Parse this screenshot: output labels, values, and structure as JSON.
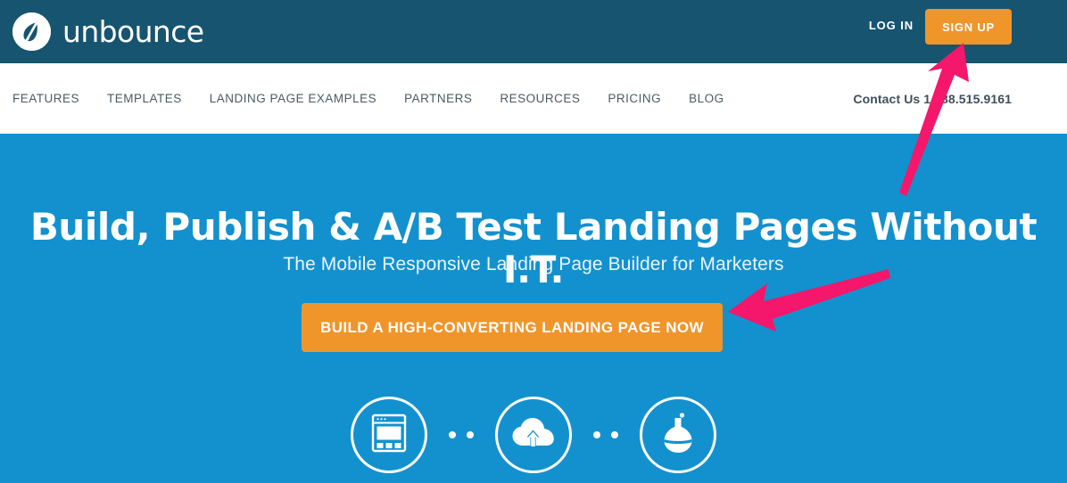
{
  "header": {
    "logo_icon": "unbounce-leaf-logo-icon",
    "logo_text": "unbounce",
    "login_label": "LOG IN",
    "signup_label": "SIGN UP",
    "background_color": "#175470",
    "signup_button_color": "#F0952A"
  },
  "nav": {
    "items": [
      {
        "label": "FEATURES"
      },
      {
        "label": "TEMPLATES"
      },
      {
        "label": "LANDING PAGE EXAMPLES"
      },
      {
        "label": "PARTNERS"
      },
      {
        "label": "RESOURCES"
      },
      {
        "label": "PRICING"
      },
      {
        "label": "BLOG"
      }
    ],
    "contact": "Contact Us 1.888.515.9161",
    "background_color": "#FFFFFF"
  },
  "hero": {
    "headline": "Build, Publish & A/B Test Landing Pages Without I.T.",
    "subheadline": "The Mobile Responsive Landing Page Builder for Marketers",
    "cta_label": "BUILD A HIGH-CONVERTING LANDING PAGE NOW",
    "background_color": "#1391CE",
    "cta_button_color": "#F0952A",
    "features": [
      {
        "icon": "landing-page-layout-icon",
        "name": "build"
      },
      {
        "icon": "cloud-upload-icon",
        "name": "publish"
      },
      {
        "icon": "flask-icon",
        "name": "test"
      }
    ]
  },
  "annotations": {
    "color": "#F4176B",
    "arrows": [
      {
        "name": "arrow-pointing-to-signup",
        "direction": "up"
      },
      {
        "name": "arrow-pointing-to-cta",
        "direction": "left"
      }
    ]
  }
}
